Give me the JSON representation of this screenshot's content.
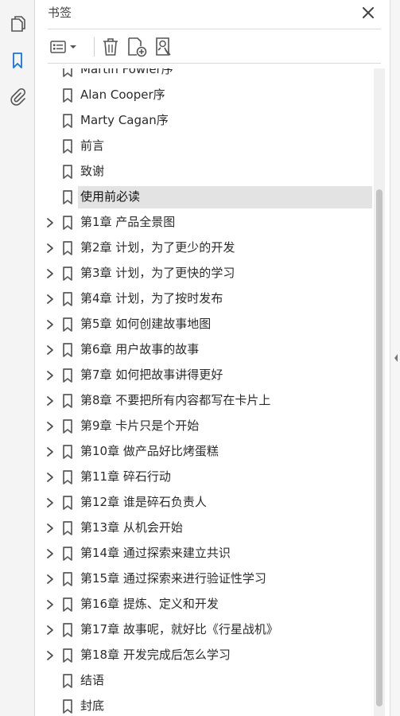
{
  "left_rail": {
    "buttons": [
      {
        "icon": "copy-pages-icon"
      },
      {
        "icon": "bookmark-icon",
        "active": true
      },
      {
        "icon": "paperclip-icon"
      }
    ]
  },
  "panel": {
    "title": "书签",
    "close_icon": "close-icon"
  },
  "toolbar": {
    "buttons": [
      "options-menu-icon",
      "trash-icon",
      "new-bookmark-icon",
      "bookmark-search-icon"
    ]
  },
  "bookmarks": [
    {
      "label": "Martin Fowler序",
      "expandable": false
    },
    {
      "label": "Alan Cooper序",
      "expandable": false
    },
    {
      "label": "Marty Cagan序",
      "expandable": false
    },
    {
      "label": "前言",
      "expandable": false
    },
    {
      "label": "致谢",
      "expandable": false
    },
    {
      "label": "使用前必读",
      "expandable": false,
      "selected": true
    },
    {
      "label": "第1章 产品全景图",
      "expandable": true
    },
    {
      "label": "第2章 计划，为了更少的开发",
      "expandable": true
    },
    {
      "label": "第3章 计划，为了更快的学习",
      "expandable": true
    },
    {
      "label": "第4章 计划，为了按时发布",
      "expandable": true
    },
    {
      "label": "第5章 如何创建故事地图",
      "expandable": true
    },
    {
      "label": "第6章 用户故事的故事",
      "expandable": true
    },
    {
      "label": "第7章 如何把故事讲得更好",
      "expandable": true
    },
    {
      "label": "第8章 不要把所有内容都写在卡片上",
      "expandable": true
    },
    {
      "label": "第9章 卡片只是个开始",
      "expandable": true
    },
    {
      "label": "第10章 做产品好比烤蛋糕",
      "expandable": true
    },
    {
      "label": "第11章 碎石行动",
      "expandable": true
    },
    {
      "label": "第12章 谁是碎石负责人",
      "expandable": true
    },
    {
      "label": "第13章 从机会开始",
      "expandable": true
    },
    {
      "label": "第14章 通过探索来建立共识",
      "expandable": true
    },
    {
      "label": "第15章 通过探索来进行验证性学习",
      "expandable": true
    },
    {
      "label": "第16章 提炼、定义和开发",
      "expandable": true
    },
    {
      "label": "第17章 故事呢，就好比《行星战机》",
      "expandable": true
    },
    {
      "label": "第18章 开发完成后怎么学习",
      "expandable": true
    },
    {
      "label": "结语",
      "expandable": false
    },
    {
      "label": "封底",
      "expandable": false
    }
  ],
  "colors": {
    "accent": "#1473e6",
    "selected_bg": "#e3e3e3",
    "icon": "#505050"
  }
}
